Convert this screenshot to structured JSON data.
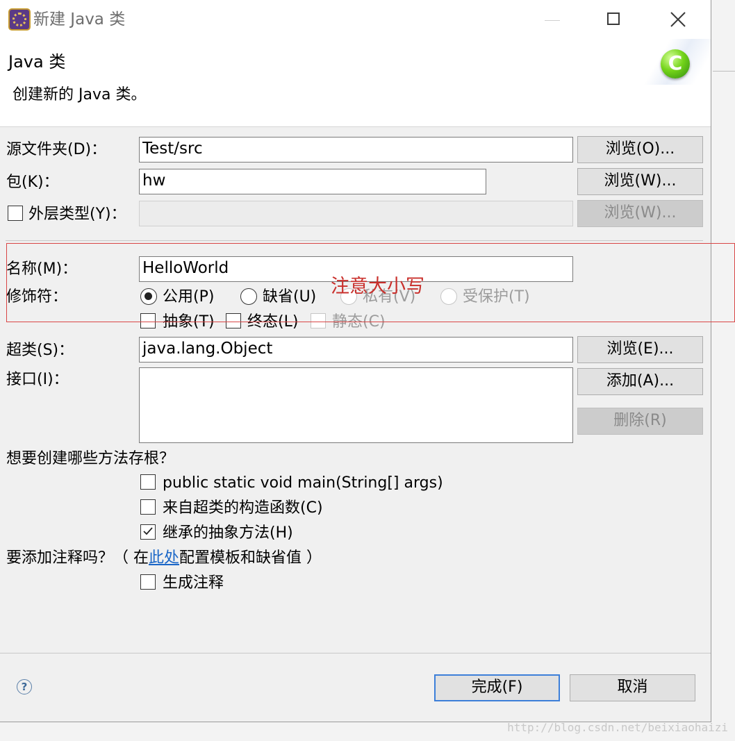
{
  "window": {
    "title": "新建 Java 类",
    "app_icon": "java-ee-ide-icon"
  },
  "banner": {
    "title": "Java 类",
    "description": "创建新的 Java 类。",
    "icon": "class-c-icon"
  },
  "form": {
    "source_folder": {
      "label": "源文件夹(D)：",
      "value": "Test/src",
      "browse": "浏览(O)..."
    },
    "package": {
      "label": "包(K)：",
      "value": "hw",
      "browse": "浏览(W)..."
    },
    "enclosing_type": {
      "label": "外层类型(Y)：",
      "checked": false,
      "value": "",
      "browse": "浏览(W)..."
    },
    "name": {
      "label": "名称(M)：",
      "value": "HelloWorld"
    },
    "modifiers": {
      "label": "修饰符：",
      "access": [
        {
          "label": "公用(P)",
          "selected": true,
          "enabled": true
        },
        {
          "label": "缺省(U)",
          "selected": false,
          "enabled": true
        },
        {
          "label": "私有(V)",
          "selected": false,
          "enabled": false
        },
        {
          "label": "受保护(T)",
          "selected": false,
          "enabled": false
        }
      ],
      "flags": [
        {
          "label": "抽象(T)",
          "checked": false,
          "enabled": true
        },
        {
          "label": "终态(L)",
          "checked": false,
          "enabled": true
        },
        {
          "label": "静态(C)",
          "checked": false,
          "enabled": false
        }
      ]
    },
    "superclass": {
      "label": "超类(S)：",
      "value": "java.lang.Object",
      "browse": "浏览(E)..."
    },
    "interfaces": {
      "label": "接口(I)：",
      "add": "添加(A)...",
      "remove": "删除(R)"
    },
    "stubs": {
      "question": "想要创建哪些方法存根？",
      "options": [
        {
          "label": "public static void main(String[] args)",
          "checked": false
        },
        {
          "label": "来自超类的构造函数(C)",
          "checked": false
        },
        {
          "label": "继承的抽象方法(H)",
          "checked": true
        }
      ]
    },
    "comments": {
      "question_prefix": "要添加注释吗？（ 在",
      "link": "此处",
      "question_suffix": "配置模板和缺省值 ）",
      "option": {
        "label": "生成注释",
        "checked": false
      }
    }
  },
  "annotation": {
    "text": "注意大小写",
    "color": "#c9302c"
  },
  "footer": {
    "help_icon": "help-question-icon",
    "finish": "完成(F)",
    "cancel": "取消"
  },
  "watermark": "http://blog.csdn.net/beixiaohaizi"
}
